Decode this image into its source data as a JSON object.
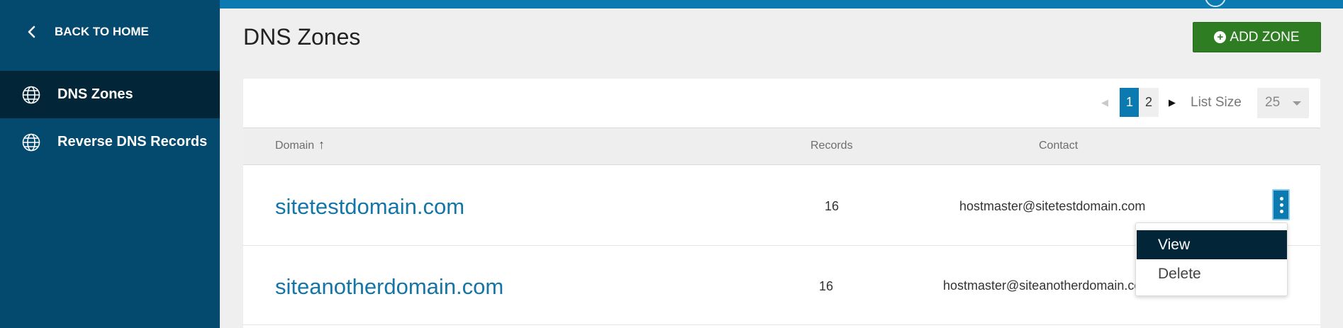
{
  "sidebar": {
    "back_label": "BACK TO HOME",
    "items": [
      {
        "label": "DNS Zones",
        "active": true,
        "icon": "globe-icon"
      },
      {
        "label": "Reverse DNS Records",
        "active": false,
        "icon": "globe-icon"
      }
    ]
  },
  "header": {
    "title": "DNS Zones",
    "add_button_label": "ADD ZONE"
  },
  "pagination": {
    "prev": "◀",
    "pages": [
      "1",
      "2"
    ],
    "current": "1",
    "next": "▶",
    "list_size_label": "List Size",
    "list_size_value": "25"
  },
  "table": {
    "columns": {
      "domain": "Domain",
      "records": "Records",
      "contact": "Contact"
    },
    "sort_indicator": "↑",
    "rows": [
      {
        "domain": "sitetestdomain.com",
        "records": "16",
        "contact": "hostmaster@sitetestdomain.com"
      },
      {
        "domain": "siteanotherdomain.com",
        "records": "16",
        "contact": "hostmaster@siteanotherdomain.com"
      }
    ]
  },
  "row_menu": {
    "items": [
      "View",
      "Delete"
    ],
    "highlighted": "View"
  },
  "colors": {
    "sidebar_bg": "#034a6e",
    "sidebar_active": "#022538",
    "accent_blue": "#0a7ab0",
    "add_button_green": "#2e7d22",
    "link_blue": "#1475a6"
  }
}
